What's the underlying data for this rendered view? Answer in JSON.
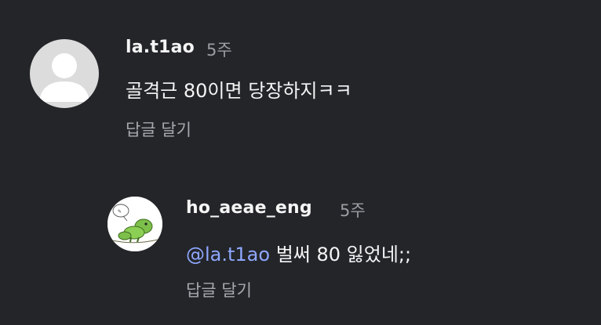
{
  "comments": [
    {
      "username": "la.t1ao",
      "time": "5주",
      "text": "골격근 80이면 당장하지ㅋㅋ",
      "reply_label": "답글 달기",
      "avatar_icon": "default-user-avatar-icon"
    }
  ],
  "replies": [
    {
      "username": "ho_aeae_eng",
      "time": "5주",
      "mention": "@la.t1ao",
      "text": " 벌써 80 잃었네;;",
      "reply_label": "답글 달기",
      "avatar_icon": "cartoon-dinosaur-avatar-icon"
    }
  ],
  "colors": {
    "background": "#232529",
    "mention": "#8fa7ff",
    "muted": "#9a9da3"
  }
}
